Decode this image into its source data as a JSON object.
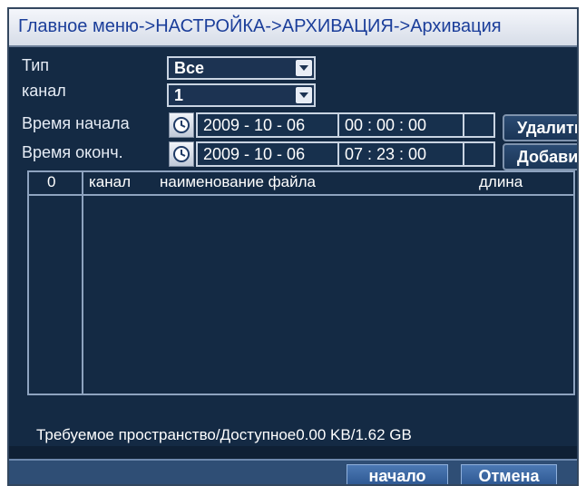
{
  "breadcrumb": "Главное меню->НАСТРОЙКА->АРХИВАЦИЯ->Архивация",
  "form": {
    "type_label": "Тип",
    "type_value": "Все",
    "channel_label": "канал",
    "channel_value": "1",
    "start_label": "Время начала",
    "start_date": "2009  -  10 - 06",
    "start_time": "00 : 00 : 00",
    "end_label": "Время оконч.",
    "end_date": "2009  -  10 - 06",
    "end_time": "07 : 23 : 00"
  },
  "buttons": {
    "delete": "Удалить",
    "add": "Добавить",
    "start": "начало",
    "cancel": "Отмена"
  },
  "table": {
    "columns": [
      "0",
      "канал",
      "наименование файла",
      "длина"
    ],
    "rows": []
  },
  "space_status": "Требуемое пространство/Доступное0.00 KB/1.62 GB",
  "colors": {
    "background": "#142a44",
    "title_text": "#1b3e9a",
    "accent_button": "#2b558f"
  }
}
